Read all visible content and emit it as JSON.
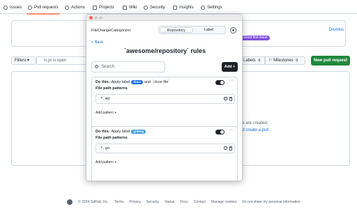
{
  "repo_tabs": [
    {
      "label": "Issues",
      "icon": "issue-icon"
    },
    {
      "label": "Pull requests",
      "icon": "pull-request-icon",
      "active": true
    },
    {
      "label": "Actions",
      "icon": "actions-icon"
    },
    {
      "label": "Projects",
      "icon": "projects-icon"
    },
    {
      "label": "Wiki",
      "icon": "wiki-icon"
    },
    {
      "label": "Security",
      "icon": "shield-icon"
    },
    {
      "label": "Insights",
      "icon": "graph-icon"
    },
    {
      "label": "Settings",
      "icon": "gear-icon"
    }
  ],
  "banner": {
    "pill": "Good first issue",
    "dismiss": "Dismiss"
  },
  "toolbar": {
    "filters": "Filters",
    "search_text": "is:pr is:open",
    "labels": "Labels",
    "labels_count": "9",
    "milestones": "Milestones",
    "milestones_count": "0",
    "new_pr": "New pull request"
  },
  "empty_state": {
    "line1": "ts are created,",
    "line2": "id create a pull"
  },
  "footer": {
    "copyright": "© 2024 GitHub, Inc.",
    "links": [
      "Terms",
      "Privacy",
      "Security",
      "Status",
      "Docs",
      "Contact",
      "Manage cookies",
      "Do not share my personal information"
    ]
  },
  "popup": {
    "app_name": "FileChangeCategorizer",
    "tabs": [
      "Repository",
      "Label"
    ],
    "active_tab": "Repository",
    "back": "< Back",
    "heading": "`awesome/repository` rules",
    "search_placeholder": "Search",
    "add_button": "Add +",
    "rules": [
      {
        "do_this": "Do this:",
        "action": "Apply label",
        "label": "docs",
        "label_color": "#1f6feb",
        "extra_and": "and",
        "extra": "`close file`",
        "enabled": true,
        "more": "···",
        "fp_title": "File path patterns",
        "pattern": "*.md",
        "add_pattern": "Add pattern +"
      },
      {
        "do_this": "Do this:",
        "action": "Apply label",
        "label": "golang",
        "label_color": "#3f9dd8",
        "extra_and": "",
        "extra": "",
        "enabled": true,
        "more": "···",
        "fp_title": "File path patterns",
        "pattern": "*.go",
        "add_pattern": "Add pattern +"
      }
    ]
  }
}
